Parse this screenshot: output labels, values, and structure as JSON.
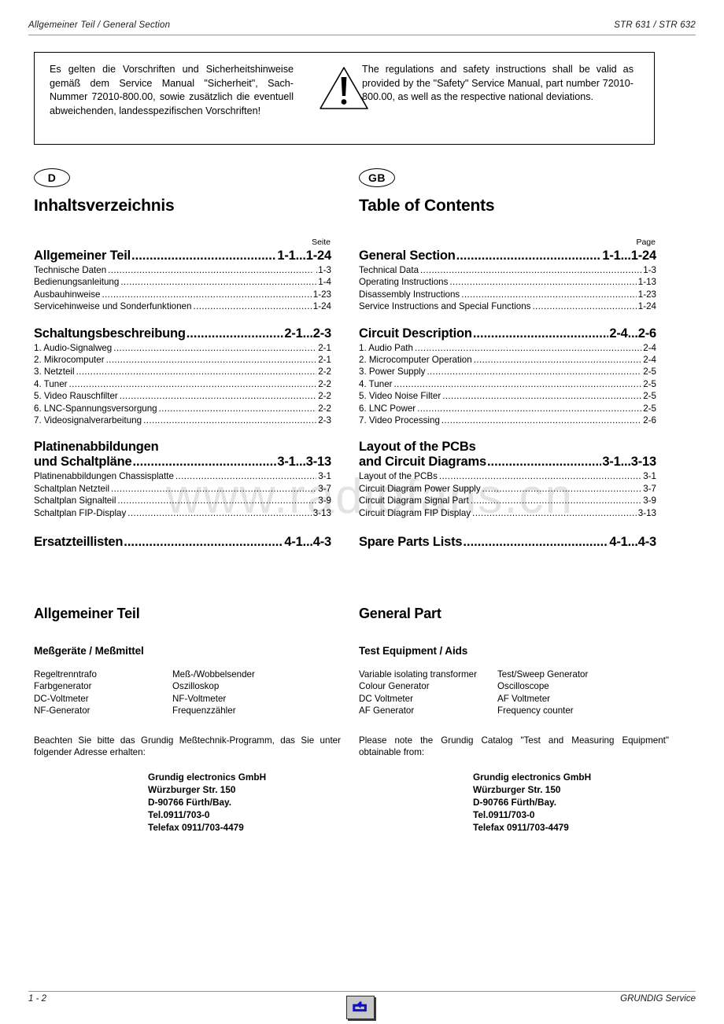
{
  "header": {
    "left": "Allgemeiner Teil / General Section",
    "right": "STR 631 / STR 632"
  },
  "warning_box": {
    "icon": "warning-triangle-icon",
    "german": "Es gelten die Vorschriften und Sicherheitshinweise gemäß dem Service Manual \"Sicherheit\", Sach-Nummer 72010-800.00, sowie zusätzlich die eventuell abweichenden, landesspezifischen Vorschriften!",
    "english": "The regulations and safety instructions shall be valid as provided by the \"Safety\" Service Manual, part number 72010-800.00, as well as the respective national deviations."
  },
  "watermark": "www.radiofans.cn",
  "german_column": {
    "badge": "D",
    "toc_title": "Inhaltsverzeichnis",
    "page_label": "Seite",
    "sections": [
      {
        "title": "Allgemeiner Teil",
        "range": "1-1...1-24",
        "items": [
          {
            "label": "Technische Daten",
            "page": ".1-3"
          },
          {
            "label": "Bedienungsanleitung",
            "page": "1-4"
          },
          {
            "label": "Ausbauhinweise",
            "page": "1-23"
          },
          {
            "label": "Servicehinweise und Sonderfunktionen",
            "page": "1-24"
          }
        ]
      },
      {
        "title": "Schaltungsbeschreibung",
        "range": "2-1...2-3",
        "items": [
          {
            "label": "1. Audio-Signalweg",
            "page": "2-1"
          },
          {
            "label": "2. Mikrocomputer",
            "page": "2-1"
          },
          {
            "label": "3. Netzteil",
            "page": "2-2"
          },
          {
            "label": "4. Tuner",
            "page": "2-2"
          },
          {
            "label": "5. Video Rauschfilter",
            "page": "2-2"
          },
          {
            "label": "6. LNC-Spannungsversorgung",
            "page": "2-2"
          },
          {
            "label": "7. Videosignalverarbeitung",
            "page": "2-3"
          }
        ]
      },
      {
        "title_line1": "Platinenabbildungen",
        "title_line2": "und Schaltpläne",
        "range": "3-1...3-13",
        "items": [
          {
            "label": "Platinenabbildungen Chassisplatte",
            "page": "3-1"
          },
          {
            "label": "Schaltplan Netzteil",
            "page": "3-7"
          },
          {
            "label": "Schaltplan Signalteil",
            "page": "3-9"
          },
          {
            "label": "Schaltplan FIP-Display",
            "page": "3-13"
          }
        ]
      },
      {
        "title": "Ersatzteillisten",
        "range": "4-1...4-3",
        "items": []
      }
    ],
    "general_part_heading": "Allgemeiner Teil",
    "equipment_heading": "Meßgeräte / Meßmittel",
    "equipment_col1": [
      "Regeltrenntrafo",
      "Farbgenerator",
      "DC-Voltmeter",
      "NF-Generator"
    ],
    "equipment_col2": [
      "Meß-/Wobbelsender",
      "Oszilloskop",
      "NF-Voltmeter",
      "Frequenzzähler"
    ],
    "note": "Beachten Sie bitte das Grundig Meßtechnik-Programm, das Sie unter folgender Adresse erhalten:",
    "address": [
      "Grundig electronics GmbH",
      "Würzburger Str. 150",
      "D-90766 Fürth/Bay.",
      "Tel.0911/703-0",
      "Telefax 0911/703-4479"
    ]
  },
  "english_column": {
    "badge": "GB",
    "toc_title": "Table of Contents",
    "page_label": "Page",
    "sections": [
      {
        "title": "General Section",
        "range": "1-1...1-24",
        "items": [
          {
            "label": "Technical Data",
            "page": "1-3"
          },
          {
            "label": "Operating Instructions",
            "page": "1-13"
          },
          {
            "label": "Disassembly Instructions",
            "page": "1-23"
          },
          {
            "label": "Service Instructions and Special Functions",
            "page": "1-24"
          }
        ]
      },
      {
        "title": "Circuit Description",
        "range": "2-4...2-6",
        "items": [
          {
            "label": "1. Audio Path",
            "page": "2-4"
          },
          {
            "label": "2. Microcomputer Operation",
            "page": "2-4"
          },
          {
            "label": "3. Power Supply",
            "page": "2-5"
          },
          {
            "label": "4. Tuner",
            "page": "2-5"
          },
          {
            "label": "5. Video Noise Filter",
            "page": "2-5"
          },
          {
            "label": "6. LNC Power",
            "page": "2-5"
          },
          {
            "label": "7. Video Processing",
            "page": "2-6"
          }
        ]
      },
      {
        "title_line1": "Layout of the PCBs",
        "title_line2": "and Circuit Diagrams",
        "range": "3-1...3-13",
        "items": [
          {
            "label": "Layout of the PCBs",
            "page": "3-1"
          },
          {
            "label": "Circuit Diagram Power Supply",
            "page": "3-7"
          },
          {
            "label": "Circuit Diagram Signal Part",
            "page": "3-9"
          },
          {
            "label": "Circuit Diagram FIP Display",
            "page": "3-13"
          }
        ]
      },
      {
        "title": "Spare Parts Lists",
        "range": "4-1...4-3",
        "items": []
      }
    ],
    "general_part_heading": "General Part",
    "equipment_heading": "Test Equipment / Aids",
    "equipment_col1": [
      "Variable isolating transformer",
      "Colour Generator",
      "DC Voltmeter",
      "AF Generator"
    ],
    "equipment_col2": [
      "Test/Sweep Generator",
      "Oscilloscope",
      "AF Voltmeter",
      "Frequency counter"
    ],
    "note": "Please note the Grundig Catalog \"Test and Measuring Equipment\" obtainable from:",
    "address": [
      "Grundig electronics GmbH",
      "Würzburger Str. 150",
      "D-90766 Fürth/Bay.",
      "Tel.0911/703-0",
      "Telefax 0911/703-4479"
    ]
  },
  "footer": {
    "page_number": "1 - 2",
    "brand": "GRUNDIG Service",
    "back_button_icon": "back-arrow-icon"
  },
  "dots": {
    "major": "..........................................................................................",
    "minor": "................................................................................................................"
  }
}
